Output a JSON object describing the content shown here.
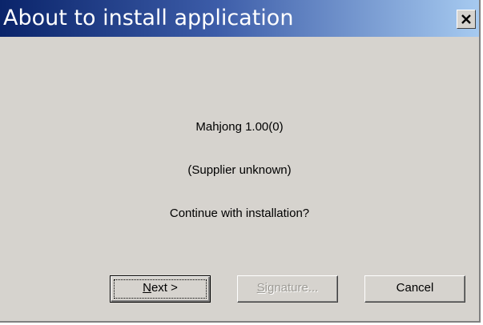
{
  "dialog": {
    "title": "About to install application",
    "app_name": "Mahjong 1.00(0)",
    "supplier": "(Supplier unknown)",
    "prompt": "Continue with installation?",
    "close_icon": "close-icon"
  },
  "buttons": {
    "next": {
      "mnemonic": "N",
      "rest": "ext >"
    },
    "signature": {
      "mnemonic": "S",
      "rest": "ignature...",
      "disabled": true
    },
    "cancel": {
      "label": "Cancel"
    }
  },
  "colors": {
    "title_gradient_start": "#0a246a",
    "title_gradient_end": "#a6caf0",
    "face": "#d6d3ce",
    "disabled_text": "#9c9a94"
  }
}
